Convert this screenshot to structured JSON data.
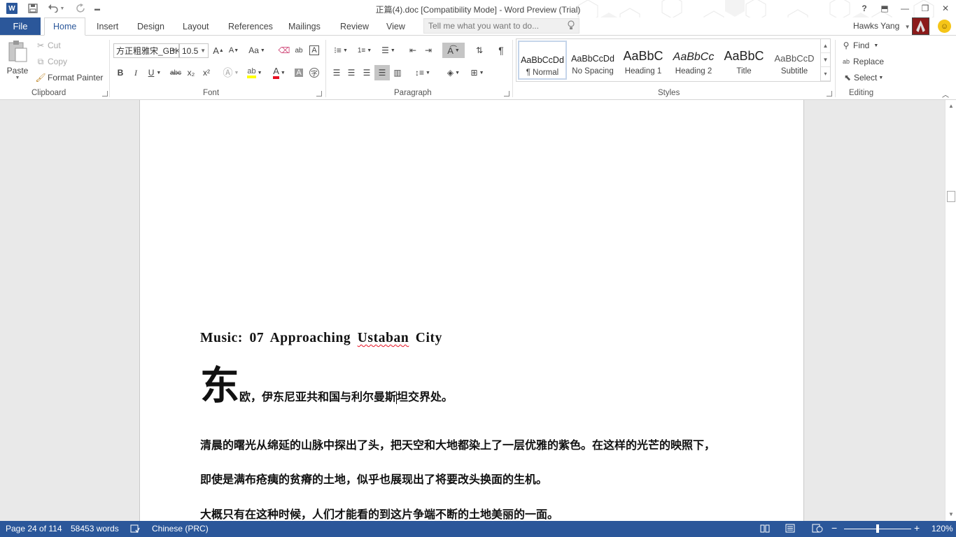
{
  "window": {
    "title": "正篇(4).doc [Compatibility Mode] - Word Preview (Trial)",
    "app_logo": "W",
    "accent": "#2b579a",
    "help": "?",
    "minimize": "—",
    "restore": "❐",
    "close": "✕",
    "ribbon_display": "⬒"
  },
  "quick_access": {
    "save_icon": "save-icon",
    "undo_icon": "undo-icon",
    "redo_icon": "redo-icon",
    "customize_icon": "customize-icon"
  },
  "tabs": {
    "file": "File",
    "items": [
      "Home",
      "Insert",
      "Design",
      "Layout",
      "References",
      "Mailings",
      "Review",
      "View"
    ],
    "active": "Home",
    "tell_me_placeholder": "Tell me what you want to do..."
  },
  "account": {
    "user_name": "Hawks Yang"
  },
  "clipboard": {
    "paste": "Paste",
    "cut": "Cut",
    "copy": "Copy",
    "format_painter": "Format Painter",
    "label": "Clipboard"
  },
  "font": {
    "font_name": "方正粗雅宋_GBK",
    "font_size": "10.5",
    "grow": "A",
    "shrink": "A",
    "change_case": "Aa",
    "bold": "B",
    "italic": "I",
    "underline": "U",
    "strikethrough": "abc",
    "subscript": "x₂",
    "superscript": "x²",
    "font_color": "A",
    "label": "Font"
  },
  "paragraph": {
    "label": "Paragraph",
    "pilcrow": "¶"
  },
  "styles": {
    "label": "Styles",
    "items": [
      {
        "preview": "AaBbCcDd",
        "name": "¶ Normal"
      },
      {
        "preview": "AaBbCcDd",
        "name": "No Spacing"
      },
      {
        "preview": "AaBbC",
        "name": "Heading 1"
      },
      {
        "preview": "AaBbCc",
        "name": "Heading 2"
      },
      {
        "preview": "AaBbC",
        "name": "Title"
      },
      {
        "preview": "AaBbCcD",
        "name": "Subtitle"
      }
    ]
  },
  "editing": {
    "find": "Find",
    "replace": "Replace",
    "select": "Select",
    "label": "Editing"
  },
  "document": {
    "music_prefix": "Music: 07 Approaching ",
    "music_squiggle": "Ustaban",
    "music_suffix": " City",
    "dropcap": "东",
    "dropcap_rest_1": "欧，伊东尼亚共和国与利尔曼斯",
    "dropcap_rest_2": "坦交界处。",
    "para1": "清晨的曙光从绵延的山脉中探出了头，把天空和大地都染上了一层优雅的紫色。在这样的光芒的映照下，",
    "para2": "即使是满布疮痍的贫瘠的土地，似乎也展现出了将要改头换面的生机。",
    "para3": "大概只有在这种时候，人们才能看的到这片争端不断的土地美丽的一面。"
  },
  "status": {
    "page": "Page 24 of 114",
    "words": "58453 words",
    "language": "Chinese (PRC)",
    "zoom": "120%",
    "zoom_level": 120
  }
}
